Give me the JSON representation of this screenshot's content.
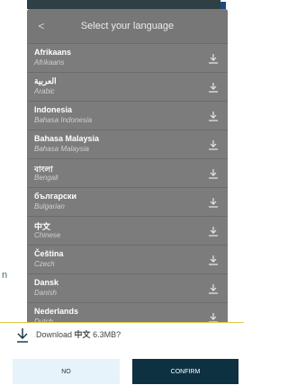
{
  "background_text": "n",
  "sheet": {
    "title": "Select your language",
    "back_icon": "chevron-left-icon"
  },
  "languages": [
    {
      "name": "Afrikaans",
      "native": "Afrikaans"
    },
    {
      "name": "العربية",
      "native": "Arabic"
    },
    {
      "name": "Indonesia",
      "native": "Bahasa Indonesia"
    },
    {
      "name": "Bahasa Malaysia",
      "native": "Bahasa Malaysia"
    },
    {
      "name": "বাংলা",
      "native": "Bengali"
    },
    {
      "name": "български",
      "native": "Bulgarian"
    },
    {
      "name": "中文",
      "native": "Chinese"
    },
    {
      "name": "Čeština",
      "native": "Czech"
    },
    {
      "name": "Dansk",
      "native": "Danish"
    },
    {
      "name": "Nederlands",
      "native": "Dutch"
    }
  ],
  "dialog": {
    "prefix": "Download",
    "language": "中文",
    "suffix": "6.3MB?",
    "no_label": "NO",
    "confirm_label": "CONFIRM"
  },
  "colors": {
    "confirm": "#0e3142",
    "no": "#e6f3fb",
    "dialog_border": "#e2c74e"
  }
}
